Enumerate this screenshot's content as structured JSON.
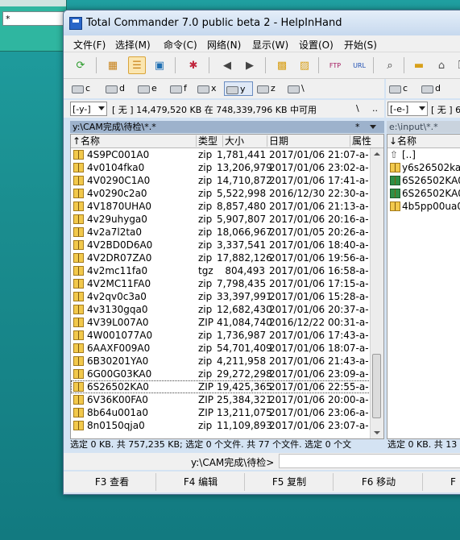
{
  "background_window": {
    "field_text": "*"
  },
  "window": {
    "title": "Total Commander 7.0 public beta 2 - HelpInHand"
  },
  "menu": [
    "文件(F)",
    "选择(M)",
    "命令(C)",
    "网络(N)",
    "显示(W)",
    "设置(O)",
    "开始(S)"
  ],
  "toolbar_icons": [
    "refresh-icon",
    "brief-view-icon",
    "full-view-icon",
    "thumbnail-view-icon",
    "invert-selection-icon",
    "back-icon",
    "forward-icon",
    "pack-icon",
    "unpack-icon",
    "ftp-icon",
    "url-icon",
    "find-icon",
    "folder-icon",
    "up-icon",
    "copy-icon"
  ],
  "left_drives": [
    "c",
    "d",
    "e",
    "f",
    "x",
    "y",
    "z",
    "\\"
  ],
  "left_selected_drive": "y",
  "right_drives": [
    "c",
    "d"
  ],
  "left_path_combo": "[-y-]",
  "left_disk_info": "[ 无 ]  14,479,520 KB 在 748,339,796 KB 中可用",
  "left_backslash": "\\",
  "left_dotdot": "..",
  "right_path_combo": "[-e-]",
  "right_disk_info": "[ 无 ]  6",
  "left_current_path": "y:\\CAM完成\\待检\\*.*",
  "left_star": "*",
  "right_current_path": "e:\\input\\*.*",
  "columns": {
    "name": "↑名称",
    "type": "类型",
    "size": "大小",
    "date": "日期",
    "attr": "属性"
  },
  "right_columns": {
    "name": "↓名称"
  },
  "left_files": [
    {
      "name": "4S9PC001A0",
      "ext": "zip",
      "size": "1,781,441",
      "date": "2017/01/06 21:07-a-"
    },
    {
      "name": "4v0104fka0",
      "ext": "zip",
      "size": "13,206,979",
      "date": "2017/01/06 23:02-a-"
    },
    {
      "name": "4V0290C1A0",
      "ext": "zip",
      "size": "14,710,872",
      "date": "2017/01/06 17:41-a-"
    },
    {
      "name": "4v0290c2a0",
      "ext": "zip",
      "size": "5,522,998",
      "date": "2016/12/30 22:30-a-"
    },
    {
      "name": "4V1870UHA0",
      "ext": "zip",
      "size": "8,857,480",
      "date": "2017/01/06 21:13-a-"
    },
    {
      "name": "4v29uhyga0",
      "ext": "zip",
      "size": "5,907,807",
      "date": "2017/01/06 20:16-a-"
    },
    {
      "name": "4v2a7l2ta0",
      "ext": "zip",
      "size": "18,066,967",
      "date": "2017/01/05 20:26-a-"
    },
    {
      "name": "4V2BD0D6A0",
      "ext": "zip",
      "size": "3,337,541",
      "date": "2017/01/06 18:40-a-"
    },
    {
      "name": "4V2DR07ZA0",
      "ext": "zip",
      "size": "17,882,126",
      "date": "2017/01/06 19:56-a-"
    },
    {
      "name": "4v2mc11fa0",
      "ext": "tgz",
      "size": "804,493",
      "date": "2017/01/06 16:58-a-"
    },
    {
      "name": "4V2MC11FA0",
      "ext": "zip",
      "size": "7,798,435",
      "date": "2017/01/06 17:15-a-"
    },
    {
      "name": "4v2qv0c3a0",
      "ext": "zip",
      "size": "33,397,991",
      "date": "2017/01/06 15:28-a-"
    },
    {
      "name": "4v3130gqa0",
      "ext": "zip",
      "size": "12,682,430",
      "date": "2017/01/06 20:37-a-"
    },
    {
      "name": "4V39L007A0",
      "ext": "ZIP",
      "size": "41,084,740",
      "date": "2016/12/22 00:31-a-"
    },
    {
      "name": "4W001077A0",
      "ext": "zip",
      "size": "1,736,987",
      "date": "2017/01/06 17:43-a-"
    },
    {
      "name": "6AAXF009A0",
      "ext": "zip",
      "size": "54,701,409",
      "date": "2017/01/06 18:07-a-"
    },
    {
      "name": "6B30201YA0",
      "ext": "zip",
      "size": "4,211,958",
      "date": "2017/01/06 21:43-a-"
    },
    {
      "name": "6G00G03KA0",
      "ext": "zip",
      "size": "29,272,298",
      "date": "2017/01/06 23:09-a-"
    },
    {
      "name": "6S26502KA0",
      "ext": "ZIP",
      "size": "19,425,365",
      "date": "2017/01/06 22:55-a-"
    },
    {
      "name": "6V36K00FA0",
      "ext": "ZIP",
      "size": "25,384,321",
      "date": "2017/01/06 20:00-a-"
    },
    {
      "name": "8b64u001a0",
      "ext": "ZIP",
      "size": "13,211,075",
      "date": "2017/01/06 23:06-a-"
    },
    {
      "name": "8n0150qja0",
      "ext": "zip",
      "size": "11,109,893",
      "date": "2017/01/06 23:07-a-"
    }
  ],
  "left_cursor_index": 18,
  "right_files": [
    {
      "name": "[..]",
      "icon": "up"
    },
    {
      "name": "y6s26502ka",
      "icon": "folder"
    },
    {
      "name": "6S26502KA0",
      "icon": "excel"
    },
    {
      "name": "6S26502KA0",
      "icon": "excel"
    },
    {
      "name": "4b5pp00ua0",
      "icon": "folder"
    }
  ],
  "status_left": "选定 0 KB. 共 757,235 KB; 选定 0 个文件. 共 77 个文件. 选定 0 个文",
  "status_right": "选定 0 KB. 共 13",
  "command_prompt": "y:\\CAM完成\\待检>",
  "fkeys": [
    "F3 查看",
    "F4 编辑",
    "F5 复制",
    "F6 移动",
    "F"
  ]
}
